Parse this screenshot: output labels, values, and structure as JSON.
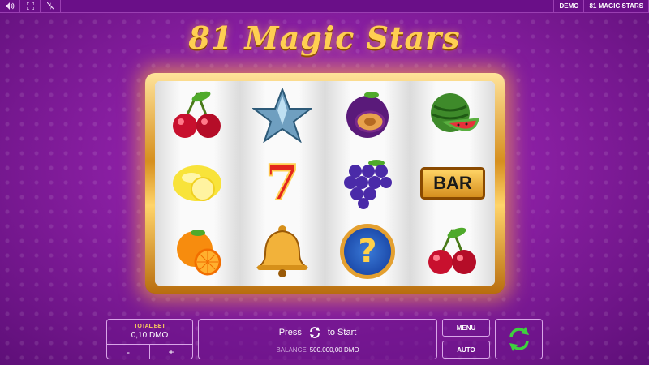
{
  "topbar": {
    "icons": [
      "sound-icon",
      "fullscreen-icon",
      "fast-mode-icon"
    ],
    "mode_label": "DEMO",
    "game_label": "81 MAGIC STARS"
  },
  "title": "81 Magic Stars",
  "reels": [
    [
      "cherries",
      "lemon",
      "orange"
    ],
    [
      "star",
      "seven",
      "bell"
    ],
    [
      "plum",
      "grapes",
      "mystery"
    ],
    [
      "watermelon",
      "bar",
      "cherries"
    ]
  ],
  "bar_symbol_text": "BAR",
  "mystery_symbol_text": "?",
  "seven_symbol_text": "7",
  "bet": {
    "label": "TOTAL BET",
    "value": "0,10 DMO",
    "minus": "-",
    "plus": "+"
  },
  "start": {
    "press_label": "Press",
    "to_start_label": "to Start",
    "balance_label": "BALANCE",
    "balance_value": "500.000,00 DMO"
  },
  "buttons": {
    "menu": "MENU",
    "auto": "AUTO"
  },
  "colors": {
    "background": "#8a1fa3",
    "title_gold": "#ffcf52",
    "frame_gold": "#d68f1e",
    "spin_green": "#3fcf3f"
  }
}
